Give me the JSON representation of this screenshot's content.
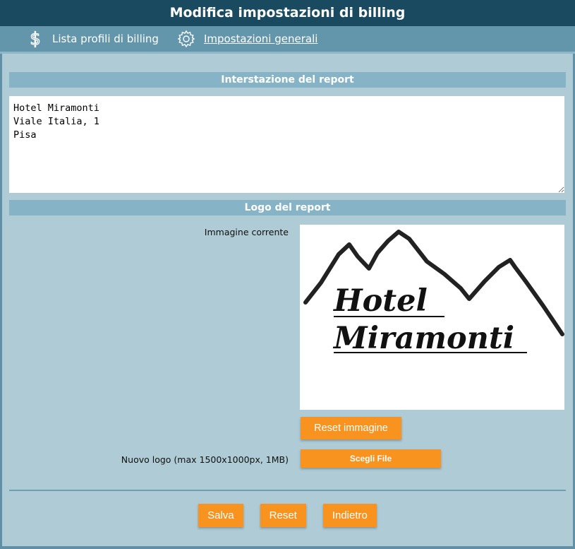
{
  "window": {
    "title": "Modifica impostazioni di billing"
  },
  "nav": {
    "items": [
      {
        "label": "Lista profili di billing",
        "icon": "dollar-icon"
      },
      {
        "label": "Impostazioni generali",
        "icon": "gear-icon"
      }
    ]
  },
  "report_heading": {
    "section_title": "Interstazione del report",
    "text": "Hotel Miramonti\nViale Italia, 1\nPisa"
  },
  "report_logo": {
    "section_title": "Logo del report",
    "current_image_label": "Immagine corrente",
    "logo_text_line1": "Hotel",
    "logo_text_line2": "Miramonti",
    "reset_image_label": "Reset immagine",
    "new_logo_label": "Nuovo logo (max 1500x1000px, 1MB)",
    "choose_file_label": "Scegli File"
  },
  "actions": {
    "save_label": "Salva",
    "reset_label": "Reset",
    "back_label": "Indietro"
  },
  "colors": {
    "titlebar": "#1a4a60",
    "navbar": "#6496ab",
    "section_header": "#86b4c6",
    "background": "#aecbd6",
    "button": "#f7931e"
  }
}
